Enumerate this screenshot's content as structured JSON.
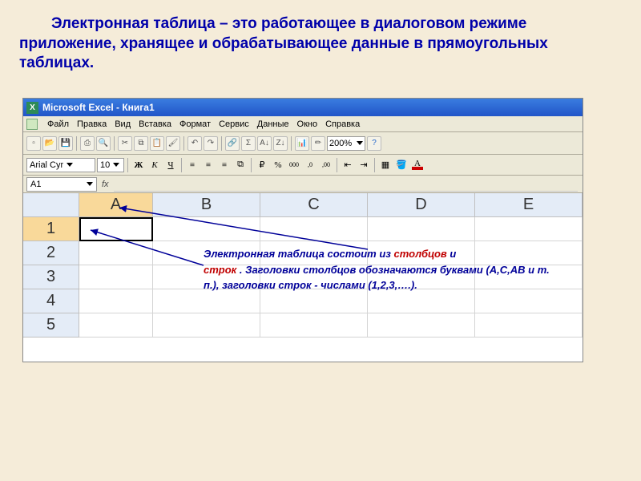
{
  "slide": {
    "heading": "Электронная таблица – это работающее в диалоговом режиме приложение, хранящее и обрабатывающее данные в прямоугольных таблицах."
  },
  "window": {
    "app_icon_letter": "X",
    "title": "Microsoft Excel - Книга1"
  },
  "menu": {
    "items": [
      "Файл",
      "Правка",
      "Вид",
      "Вставка",
      "Формат",
      "Сервис",
      "Данные",
      "Окно",
      "Справка"
    ]
  },
  "toolbar": {
    "zoom": "200%"
  },
  "format_bar": {
    "font": "Arial Cyr",
    "size": "10",
    "buttons": {
      "bold": "Ж",
      "italic": "К",
      "underline": "Ч",
      "currency": "%",
      "thousands": "000",
      "decimal_inc": ",0",
      "decimal_dec": ",00",
      "font_A": "A"
    }
  },
  "name_box": {
    "value": "A1",
    "fx": "fx"
  },
  "sheet": {
    "columns": [
      "A",
      "B",
      "C",
      "D",
      "E"
    ],
    "rows": [
      "1",
      "2",
      "3",
      "4",
      "5"
    ],
    "active_col": "A",
    "active_row": "1"
  },
  "annotation": {
    "line1a": "Электронная таблица состоит из ",
    "kw1": "столбцов",
    "line1b": " и ",
    "kw2": "строк",
    "line2": " . Заголовки столбцов обозначаются буквами (А,С,АВ и т. п.), заголовки строк - числами (1,2,3,….)."
  }
}
